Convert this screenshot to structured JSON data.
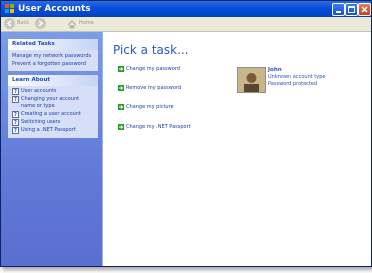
{
  "window": {
    "title": "User Accounts"
  },
  "toolbar": {
    "back_label": "Back",
    "home_label": "Home"
  },
  "sidebar": {
    "related_tasks": {
      "header": "Related Tasks",
      "links": [
        "Manage my network passwords",
        "Prevent a forgotten password"
      ]
    },
    "learn_about": {
      "header": "Learn About",
      "items": [
        "User accounts",
        "Changing your account",
        "name or type",
        "Creating a user account",
        "Switching users",
        "Using a .NET Passport"
      ]
    }
  },
  "main": {
    "heading": "Pick a task...",
    "tasks": [
      "Change my password",
      "Remove my password",
      "Change my picture",
      "Change my .NET Passport"
    ]
  },
  "user": {
    "name": "John",
    "account_type": "Unknown account type",
    "password_status": "Password protected"
  },
  "colors": {
    "titlebar": "#0a4bd8",
    "sidebar": "#6279d8",
    "link": "#1c3da8",
    "heading": "#2b58c8"
  },
  "icons": [
    "app-icon",
    "minimize-icon",
    "maximize-icon",
    "close-icon",
    "back-arrow-icon",
    "forward-arrow-icon",
    "home-icon",
    "help-icon",
    "green-arrow-icon",
    "user-picture"
  ]
}
